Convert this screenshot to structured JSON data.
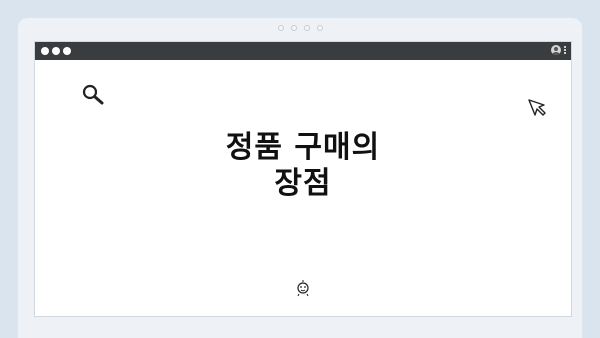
{
  "headline": {
    "line1": "정품 구매의",
    "line2": "장점"
  },
  "icons": {
    "window_controls": "window-dots",
    "profile": "avatar-icon",
    "menu": "kebab-menu-icon",
    "search": "search-icon",
    "cursor": "cursor-arrow-icon",
    "decoration": "smiley-icon"
  },
  "colors": {
    "background": "#d9e4ef",
    "titlebar": "#3a3d40",
    "window": "#ffffff",
    "text": "#111111"
  }
}
